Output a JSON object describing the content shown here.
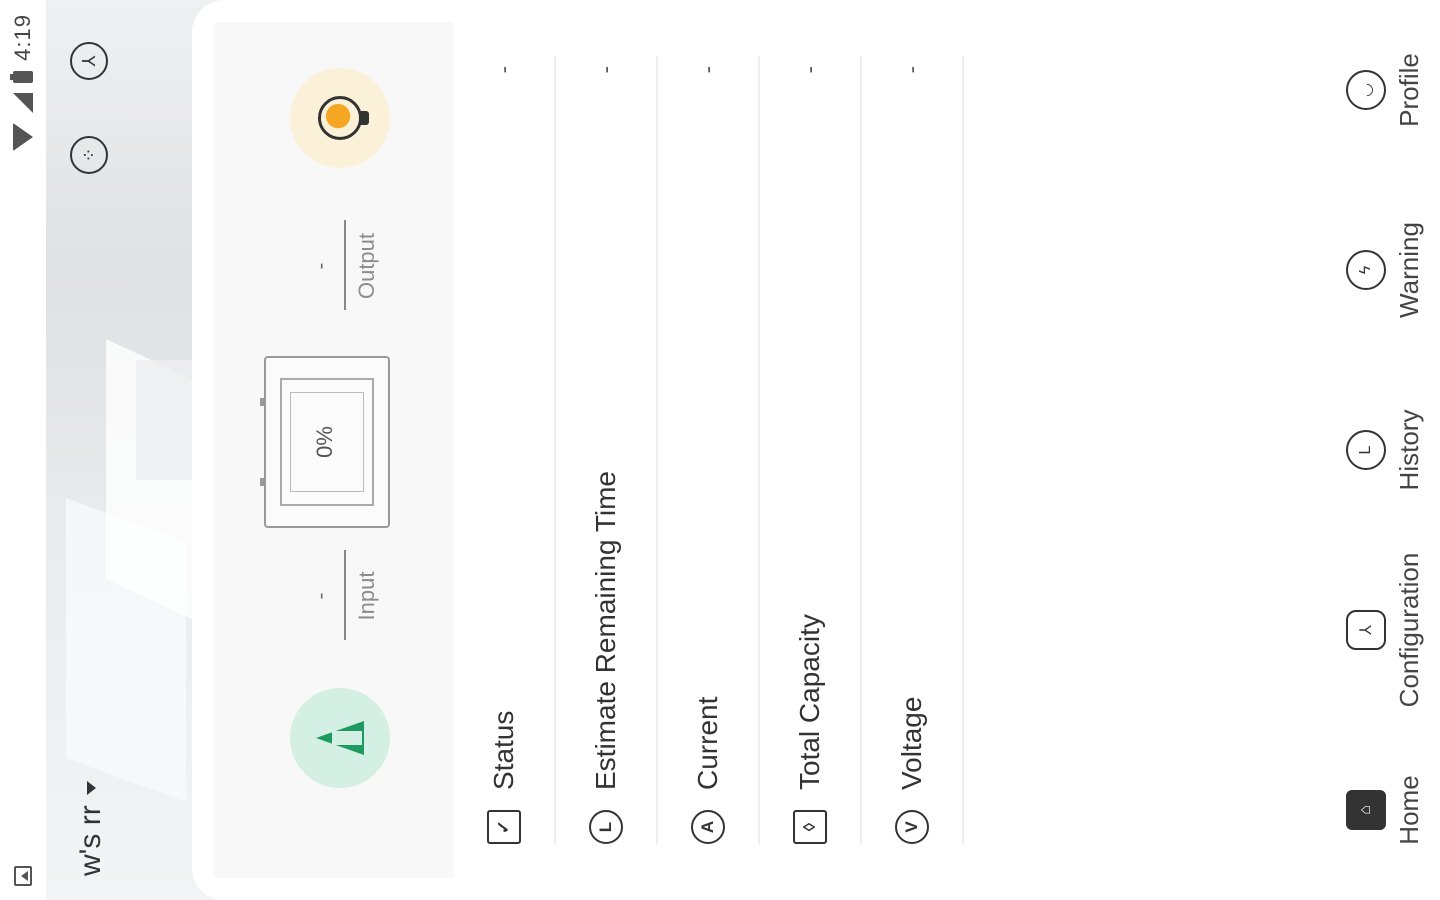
{
  "status_bar": {
    "time": "4:19"
  },
  "header": {
    "device_name": "w's rr",
    "icons": [
      "scan-icon",
      "settings-icon"
    ]
  },
  "flow": {
    "input_label": "Input",
    "input_value": "-",
    "output_label": "Output",
    "output_value": "-",
    "battery_percent": "0%",
    "colors": {
      "input_bg": "#d4efe3",
      "input_icon": "#1c9a5f",
      "output_bg": "#fbf0d8",
      "output_icon": "#f5a623"
    }
  },
  "rows": [
    {
      "icon": "status-icon",
      "label": "Status",
      "value": "-"
    },
    {
      "icon": "clock-icon",
      "label": "Estimate Remaining Time",
      "value": "-"
    },
    {
      "icon": "current-icon",
      "label": "Current",
      "value": "-"
    },
    {
      "icon": "capacity-icon",
      "label": "Total Capacity",
      "value": "-"
    },
    {
      "icon": "voltage-icon",
      "label": "Voltage",
      "value": "-"
    }
  ],
  "nav": [
    {
      "icon": "home-icon",
      "label": "Home"
    },
    {
      "icon": "configuration-icon",
      "label": "Configuration"
    },
    {
      "icon": "history-icon",
      "label": "History"
    },
    {
      "icon": "warning-icon",
      "label": "Warning"
    },
    {
      "icon": "profile-icon",
      "label": "Profile"
    }
  ]
}
